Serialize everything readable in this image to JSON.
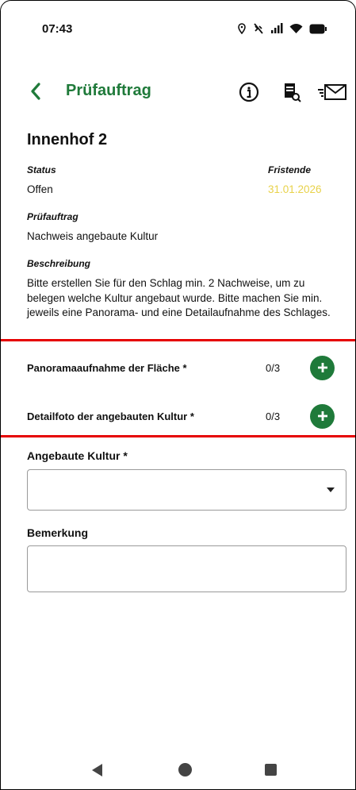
{
  "status_bar": {
    "time": "07:43"
  },
  "app_bar": {
    "title": "Prüfauftrag"
  },
  "header": {
    "title": "Innenhof 2"
  },
  "status": {
    "label": "Status",
    "value": "Offen"
  },
  "deadline": {
    "label": "Fristende",
    "value": "31.01.2026",
    "color": "#e8d24a"
  },
  "task": {
    "label": "Prüfauftrag",
    "value": "Nachweis angebaute Kultur"
  },
  "description": {
    "label": "Beschreibung",
    "text": "Bitte erstellen Sie für den Schlag min. 2 Nachweise, um zu belegen welche Kultur angebaut wurde. Bitte machen Sie min. jeweils eine Panorama- und eine Detailaufnahme des Schlages."
  },
  "photo_rows": [
    {
      "label": "Panoramaaufnahme der Fläche *",
      "count": "0/3",
      "uploaded": 0,
      "max": 3
    },
    {
      "label": "Detailfoto der angebauten Kultur *",
      "count": "0/3",
      "uploaded": 0,
      "max": 3
    }
  ],
  "crop_field": {
    "label": "Angebaute Kultur *",
    "value": ""
  },
  "remark_field": {
    "label": "Bemerkung",
    "value": ""
  },
  "colors": {
    "brand": "#1f7a3a",
    "highlight": "#e60000",
    "deadline": "#e8d24a"
  },
  "icons": {
    "back": "chevron-left-icon",
    "info": "info-icon",
    "document": "document-search-icon",
    "mail": "mail-send-icon",
    "add": "plus-icon"
  }
}
